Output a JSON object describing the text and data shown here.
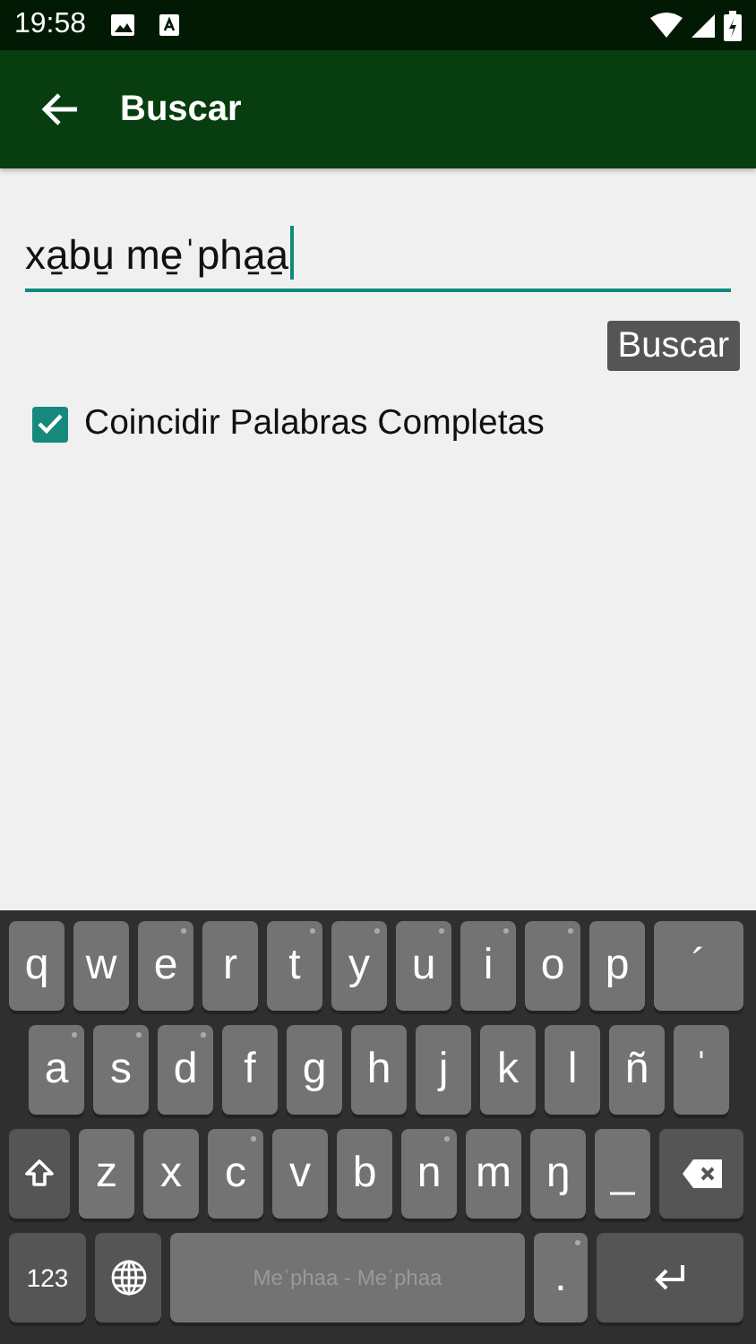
{
  "status_bar": {
    "time": "19:58"
  },
  "app_bar": {
    "title": "Buscar"
  },
  "search": {
    "value": "xa̱bu̱ me̱ˈpha̱a̱",
    "focused": true,
    "button": "Buscar"
  },
  "options": [
    {
      "label": "Coincidir Palabras Completas",
      "checked": true
    }
  ],
  "keyboard": {
    "top_keys": [
      {
        "kind": "letter",
        "label": "q",
        "dot": false
      },
      {
        "kind": "letter",
        "label": "w",
        "dot": false
      },
      {
        "kind": "letter",
        "label": "e",
        "dot": true
      },
      {
        "kind": "letter",
        "label": "r",
        "dot": false
      },
      {
        "kind": "letter",
        "label": "t",
        "dot": true
      },
      {
        "kind": "letter",
        "label": "y",
        "dot": true
      },
      {
        "kind": "letter",
        "label": "u",
        "dot": true
      },
      {
        "kind": "letter",
        "label": "i",
        "dot": true
      },
      {
        "kind": "letter",
        "label": "o",
        "dot": true
      },
      {
        "kind": "letter",
        "label": "p",
        "dot": false
      },
      {
        "kind": "wide",
        "label": "´",
        "dot": false
      }
    ],
    "home_keys": [
      {
        "kind": "letter",
        "label": "a",
        "dot": true
      },
      {
        "kind": "letter",
        "label": "s",
        "dot": true
      },
      {
        "kind": "letter",
        "label": "d",
        "dot": true
      },
      {
        "kind": "letter",
        "label": "f",
        "dot": false
      },
      {
        "kind": "letter",
        "label": "g",
        "dot": false
      },
      {
        "kind": "letter",
        "label": "h",
        "dot": false
      },
      {
        "kind": "letter",
        "label": "j",
        "dot": false
      },
      {
        "kind": "letter",
        "label": "k",
        "dot": false
      },
      {
        "kind": "letter",
        "label": "l",
        "dot": false
      },
      {
        "kind": "letter",
        "label": "ñ",
        "dot": false
      },
      {
        "kind": "letter",
        "label": "ˈ",
        "dot": false
      }
    ],
    "lower_keys": [
      {
        "kind": "shift"
      },
      {
        "kind": "letter",
        "label": "z",
        "dot": false
      },
      {
        "kind": "letter",
        "label": "x",
        "dot": false
      },
      {
        "kind": "letter",
        "label": "c",
        "dot": true
      },
      {
        "kind": "letter",
        "label": "v",
        "dot": false
      },
      {
        "kind": "letter",
        "label": "b",
        "dot": false
      },
      {
        "kind": "letter",
        "label": "n",
        "dot": true
      },
      {
        "kind": "letter",
        "label": "m",
        "dot": false
      },
      {
        "kind": "letter",
        "label": "ŋ",
        "dot": false
      },
      {
        "kind": "letter",
        "label": "_",
        "dot": false
      },
      {
        "kind": "backspace"
      }
    ],
    "bottom_keys": [
      {
        "kind": "numbers",
        "label": "123"
      },
      {
        "kind": "globe"
      },
      {
        "kind": "space",
        "label": "Meˈphaa - Meˈphaa"
      },
      {
        "kind": "period",
        "label": ".",
        "dot": true
      },
      {
        "kind": "enter"
      }
    ]
  }
}
